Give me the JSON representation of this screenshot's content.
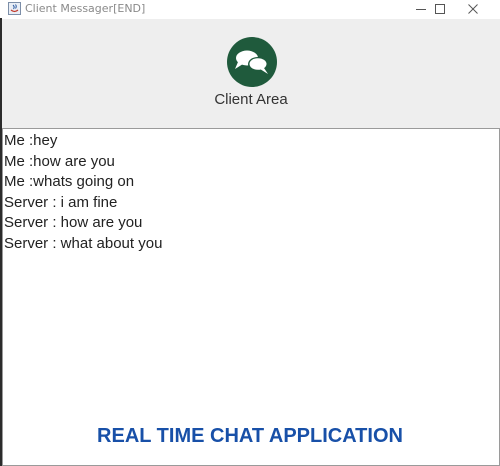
{
  "window": {
    "title": "Client Messager[END]"
  },
  "header": {
    "title": "Client Area"
  },
  "chat": {
    "messages": [
      "Me :hey",
      "Me :how are you",
      "Me :whats going on",
      "Server : i am fine",
      "Server : how are you",
      "Server : what about you"
    ]
  },
  "footer": {
    "caption": "REAL TIME CHAT APPLICATION"
  },
  "colors": {
    "logo_green": "#1f5a3c",
    "caption_blue": "#1850a8",
    "header_bg": "#eeeeee"
  }
}
